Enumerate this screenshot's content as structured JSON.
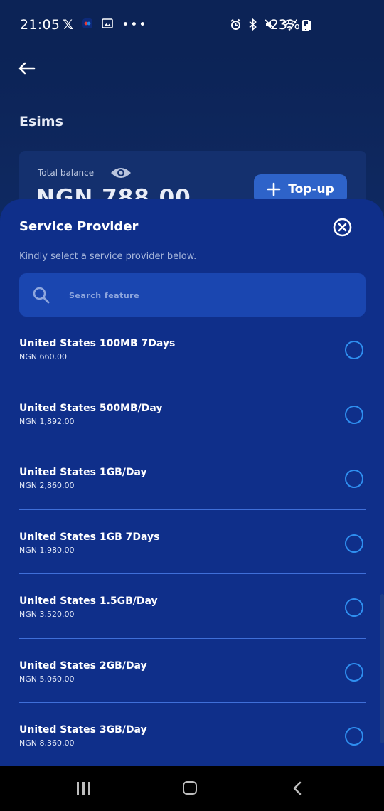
{
  "status_bar": {
    "time": "21:05",
    "battery": "23%",
    "left_icons": [
      "x-icon",
      "app-icon",
      "image-icon",
      "more-icon"
    ],
    "right_icons": [
      "alarm-icon",
      "bluetooth-icon",
      "mute-icon",
      "wifi-icon",
      "signal-icon",
      "battery-icon"
    ]
  },
  "page": {
    "title": "Esims",
    "balance_label": "Total balance",
    "balance_value": "NGN 788.00",
    "topup_label": "Top-up"
  },
  "sheet": {
    "title": "Service Provider",
    "subtitle": "Kindly select a service provider below.",
    "search_placeholder": "Search feature",
    "plans": [
      {
        "name": "United States 100MB 7Days",
        "price": "NGN 660.00"
      },
      {
        "name": "United States 500MB/Day",
        "price": "NGN 1,892.00"
      },
      {
        "name": "United States 1GB/Day",
        "price": "NGN 2,860.00"
      },
      {
        "name": "United States 1GB 7Days",
        "price": "NGN 1,980.00"
      },
      {
        "name": "United States 1.5GB/Day",
        "price": "NGN 3,520.00"
      },
      {
        "name": "United States 2GB/Day",
        "price": "NGN 5,060.00"
      },
      {
        "name": "United States 3GB/Day",
        "price": "NGN 8,360.00"
      }
    ]
  },
  "colors": {
    "background": "#0c2356",
    "sheet": "#0f2f8a",
    "search": "#1a46b0",
    "accent": "#2f8ff0",
    "topup": "#2e63c9"
  }
}
